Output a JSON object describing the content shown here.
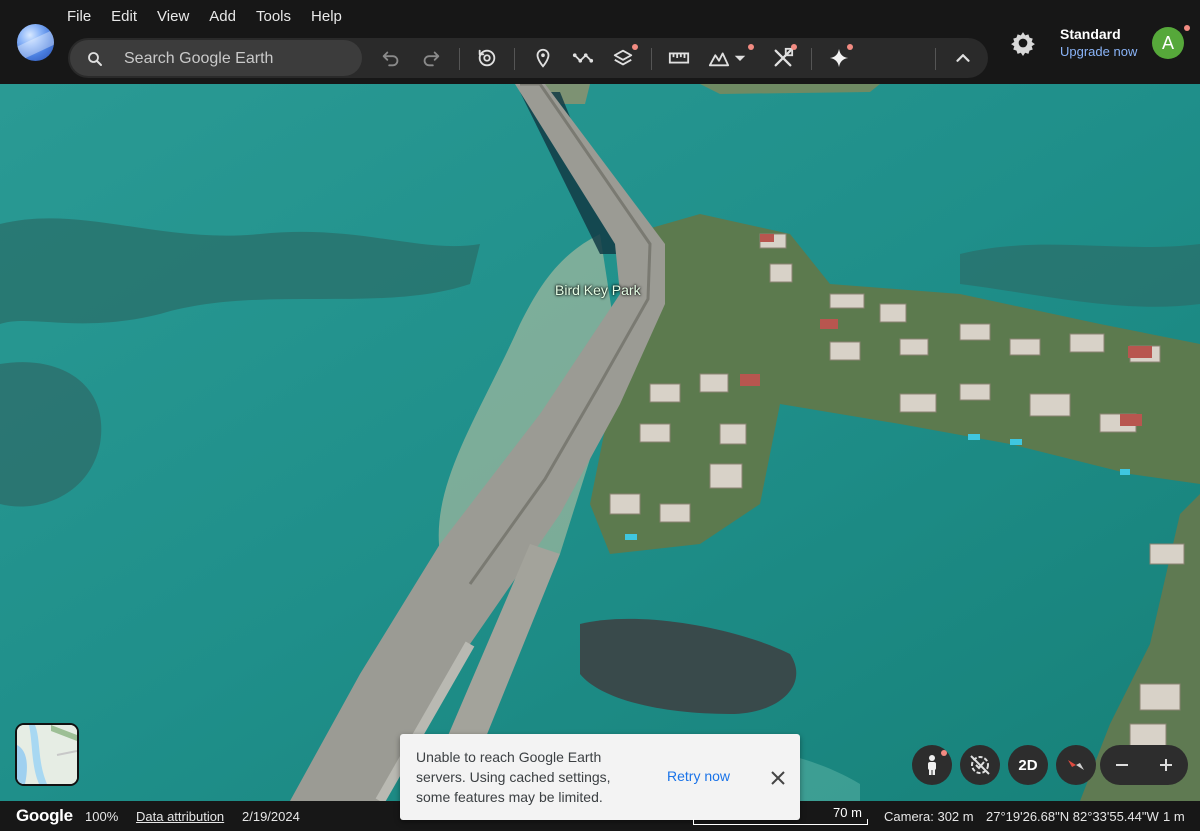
{
  "app": {
    "name": "Google Earth"
  },
  "menu": [
    {
      "label": "File"
    },
    {
      "label": "Edit"
    },
    {
      "label": "View"
    },
    {
      "label": "Add"
    },
    {
      "label": "Tools"
    },
    {
      "label": "Help"
    }
  ],
  "search": {
    "placeholder": "Search Google Earth"
  },
  "toolbar": {
    "icons": [
      "undo-icon",
      "redo-icon",
      "history-icon",
      "placemark-icon",
      "path-icon",
      "layers-icon",
      "measure-icon",
      "elevation-icon",
      "tools-icon",
      "gemini-icon",
      "collapse-icon"
    ]
  },
  "account": {
    "plan": "Standard",
    "upgrade": "Upgrade now",
    "avatar_initial": "A",
    "avatar_color": "#56a83a"
  },
  "map": {
    "place_label": "Bird Key Park"
  },
  "controls": {
    "view_mode": "2D"
  },
  "toast": {
    "message": "Unable to reach Google Earth servers. Using cached settings, some features may be limited.",
    "action": "Retry now"
  },
  "status": {
    "brand": "Google",
    "zoom": "100%",
    "attribution": "Data attribution",
    "date": "2/19/2024",
    "scale": "70 m",
    "camera": "Camera: 302 m",
    "coordinates": "27°19'26.68\"N 82°33'55.44\"W",
    "elevation": "1 m"
  },
  "colors": {
    "accent": "#8ab4f8",
    "notification": "#f28b82",
    "water": "#1f8f8a"
  }
}
